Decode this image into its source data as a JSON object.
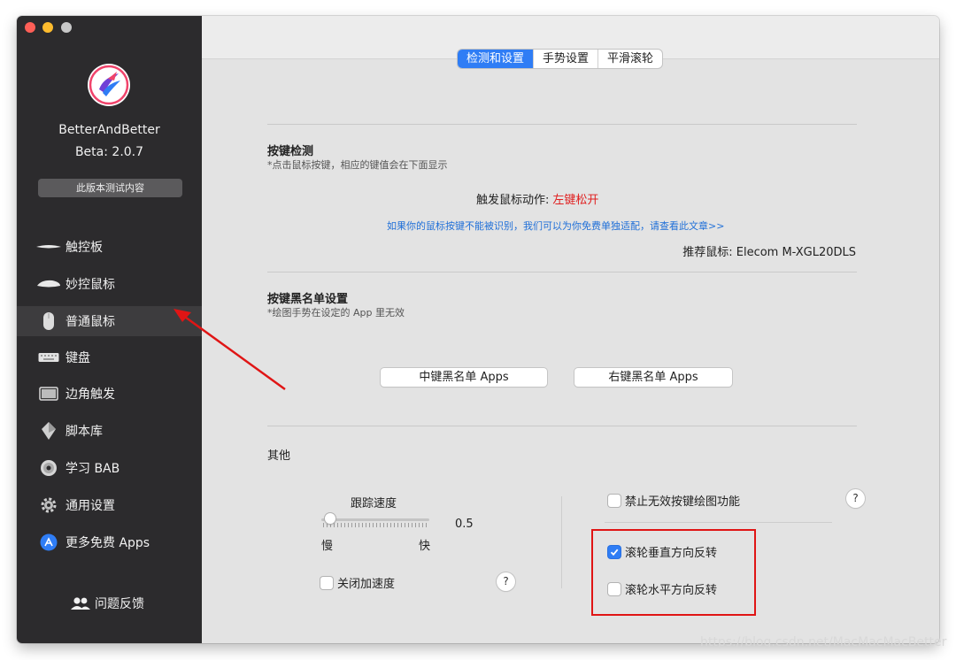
{
  "sidebar": {
    "app_name": "BetterAndBetter",
    "version": "Beta: 2.0.7",
    "beta_button": "此版本测试内容",
    "items": [
      {
        "label": "触控板",
        "icon": "trackpad-icon"
      },
      {
        "label": "妙控鼠标",
        "icon": "magic-mouse-icon"
      },
      {
        "label": "普通鼠标",
        "icon": "mouse-icon"
      },
      {
        "label": "键盘",
        "icon": "keyboard-icon"
      },
      {
        "label": "边角触发",
        "icon": "corner-trigger-icon"
      },
      {
        "label": "脚本库",
        "icon": "script-library-icon"
      },
      {
        "label": "学习 BAB",
        "icon": "learn-disc-icon"
      },
      {
        "label": "通用设置",
        "icon": "gear-icon"
      },
      {
        "label": "更多免费 Apps",
        "icon": "app-store-icon"
      }
    ],
    "active_item": "普通鼠标",
    "feedback": "问题反馈"
  },
  "tabs": [
    "检测和设置",
    "手势设置",
    "平滑滚轮"
  ],
  "selected_tab": "检测和设置",
  "key_detection": {
    "title": "按键检测",
    "subtitle": "*点击鼠标按键，相应的键值会在下面显示",
    "trigger_label": "触发鼠标动作:",
    "trigger_value": "左键松开",
    "link_text": "如果你的鼠标按键不能被识别，我们可以为你免费单独适配，请查看此文章>>",
    "recommend": "推荐鼠标: Elecom M-XGL20DLS"
  },
  "blacklist": {
    "title": "按键黑名单设置",
    "subtitle": "*绘图手势在设定的 App 里无效",
    "middle_button": "中键黑名单 Apps",
    "right_button": "右键黑名单 Apps"
  },
  "other": {
    "title": "其他",
    "tracking_speed_label": "跟踪速度",
    "tracking_speed_value": "0.5",
    "tracking_speed_level": 0.05,
    "slow_label": "慢",
    "fast_label": "快",
    "disable_accel_label": "关闭加速度",
    "disable_accel_checked": false,
    "disable_invalid_draw_label": "禁止无效按键绘图功能",
    "disable_invalid_draw_checked": false,
    "reverse_vertical_label": "滚轮垂直方向反转",
    "reverse_vertical_checked": true,
    "reverse_horizontal_label": "滚轮水平方向反转",
    "reverse_horizontal_checked": false,
    "help_mark": "?"
  },
  "watermark": "https://blog.csdn.net/MacMacMacBetter",
  "colors": {
    "sidebar_bg": "#2c2b2d",
    "accent": "#2f7df5",
    "annotation_red": "#e01515",
    "link": "#1f6fd8"
  }
}
